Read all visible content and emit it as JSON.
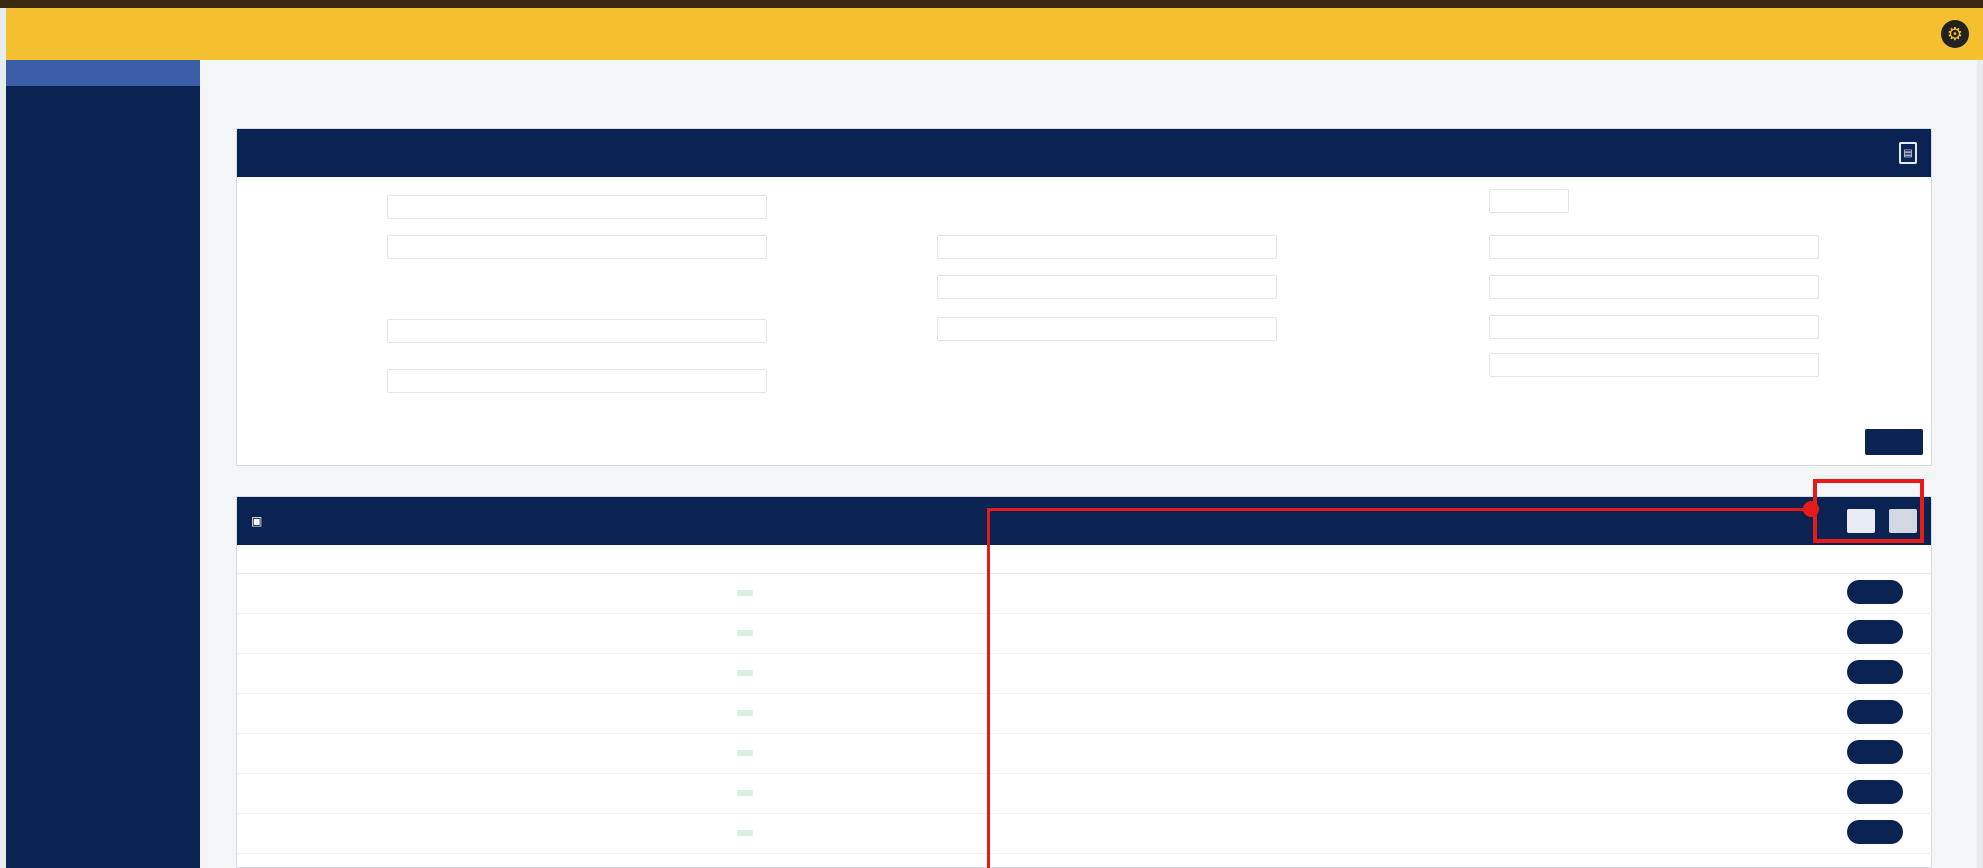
{
  "topbar": {
    "brand": "",
    "user_text": "",
    "settings_icon": "gear-icon"
  },
  "sidebar": {
    "items": [
      {
        "label": ""
      },
      {
        "label": ""
      },
      {
        "label": ""
      },
      {
        "label": ""
      },
      {
        "label": ""
      },
      {
        "label": ""
      },
      {
        "label": ""
      },
      {
        "label": ""
      }
    ]
  },
  "breadcrumb": "",
  "filter": {
    "title": "",
    "fields": [
      {
        "label": "",
        "value": ""
      },
      {
        "label": "",
        "value": ""
      },
      {
        "label": "",
        "value": ""
      },
      {
        "label": "",
        "value": ""
      },
      {
        "label": "",
        "value": ""
      },
      {
        "label": "",
        "value": ""
      },
      {
        "label": "",
        "value": ""
      },
      {
        "label": "",
        "value": ""
      },
      {
        "label": "",
        "value": ""
      },
      {
        "label": "",
        "value": ""
      },
      {
        "label": "",
        "value": ""
      },
      {
        "label": "",
        "value": ""
      }
    ],
    "search_label": ""
  },
  "list": {
    "title": "",
    "toolbar_text": "",
    "button_1": "",
    "button_2": "",
    "columns": [
      "",
      "",
      "",
      "",
      "",
      "",
      "",
      "",
      "",
      "",
      "",
      "",
      ""
    ],
    "rows": [
      [
        "",
        "",
        "",
        "",
        "",
        "",
        "",
        "",
        "",
        "",
        "",
        ""
      ],
      [
        "",
        "",
        "",
        "",
        "",
        "",
        "",
        "",
        "",
        "",
        "",
        ""
      ],
      [
        "",
        "",
        "",
        "",
        "",
        "",
        "",
        "",
        "",
        "",
        "",
        ""
      ],
      [
        "",
        "",
        "",
        "",
        "",
        "",
        "",
        "",
        "",
        "",
        "",
        ""
      ],
      [
        "",
        "",
        "",
        "",
        "",
        "",
        "",
        "",
        "",
        "",
        "",
        ""
      ],
      [
        "",
        "",
        "",
        "",
        "",
        "",
        "",
        "",
        "",
        "",
        "",
        ""
      ],
      [
        "",
        "",
        "",
        "",
        "",
        "",
        "",
        "",
        "",
        "",
        "",
        ""
      ]
    ]
  },
  "colors": {
    "navy": "#0b2352",
    "accent": "#f5c02f",
    "highlight": "#e41b17"
  }
}
